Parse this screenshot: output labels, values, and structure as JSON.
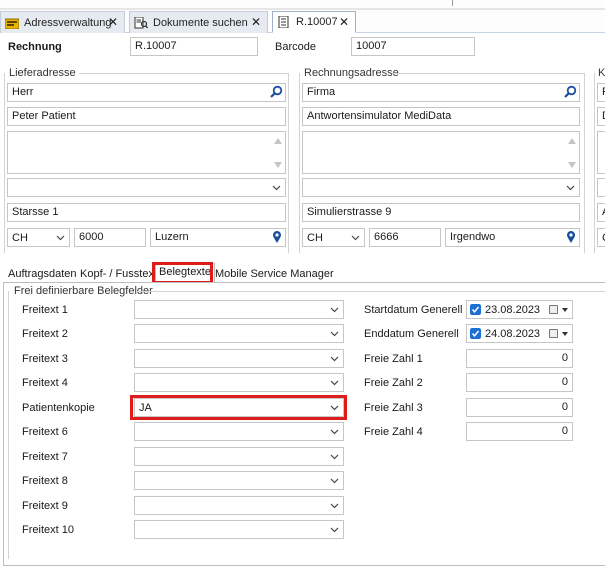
{
  "tabs": [
    {
      "label": "Adressverwaltung",
      "icon": "folder-icon"
    },
    {
      "label": "Dokumente suchen",
      "icon": "search-documents-icon"
    },
    {
      "label": "R.10007",
      "icon": "document-icon"
    }
  ],
  "header": {
    "rechnung_label": "Rechnung",
    "rechnung_value": "R.10007",
    "barcode_label": "Barcode",
    "barcode_value": "10007"
  },
  "lieferadresse": {
    "title": "Lieferadresse",
    "salutation": "Herr",
    "name": "Peter Patient",
    "street": "Starsse 1",
    "country": "CH",
    "zip": "6000",
    "city": "Luzern"
  },
  "rechnungsadresse": {
    "title": "Rechnungsadresse",
    "salutation": "Firma",
    "name": "Antwortensimulator MediData",
    "street": "Simulierstrasse 9",
    "country": "CH",
    "zip": "6666",
    "city": "Irgendwo"
  },
  "third_column": {
    "title": "K",
    "salutation": "F",
    "name": "D",
    "street": "A",
    "country": "C"
  },
  "inner_tabs": [
    "Auftragsdaten",
    "Kopf- / Fusstext",
    "Belegtexte",
    "Mobile Service Manager"
  ],
  "panel": {
    "title": "Frei definierbare Belegfelder",
    "freitexte": [
      {
        "label": "Freitext 1",
        "value": ""
      },
      {
        "label": "Freitext 2",
        "value": ""
      },
      {
        "label": "Freitext 3",
        "value": ""
      },
      {
        "label": "Freitext 4",
        "value": ""
      },
      {
        "label": "Patientenkopie",
        "value": "JA"
      },
      {
        "label": "Freitext 6",
        "value": ""
      },
      {
        "label": "Freitext 7",
        "value": ""
      },
      {
        "label": "Freitext 8",
        "value": ""
      },
      {
        "label": "Freitext 9",
        "value": ""
      },
      {
        "label": "Freitext 10",
        "value": ""
      }
    ],
    "dates": [
      {
        "label": "Startdatum Generell",
        "value": "23.08.2023"
      },
      {
        "label": "Enddatum Generell",
        "value": "24.08.2023"
      }
    ],
    "numbers": [
      {
        "label": "Freie Zahl 1",
        "value": "0"
      },
      {
        "label": "Freie Zahl 2",
        "value": "0"
      },
      {
        "label": "Freie Zahl 3",
        "value": "0"
      },
      {
        "label": "Freie Zahl 4",
        "value": "0"
      }
    ]
  },
  "colors": {
    "highlight": "#e01b1b",
    "accent": "#1d6fd1"
  }
}
